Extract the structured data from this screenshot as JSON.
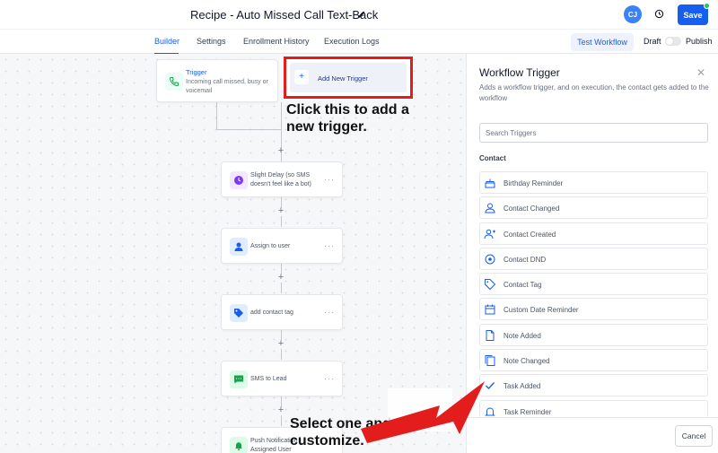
{
  "header": {
    "title": "Recipe - Auto Missed Call Text-Back",
    "avatar_initials": "CJ",
    "save_label": "Save"
  },
  "tabs": [
    {
      "label": "Builder",
      "active": true
    },
    {
      "label": "Settings"
    },
    {
      "label": "Enrollment History"
    },
    {
      "label": "Execution Logs"
    }
  ],
  "toolbar": {
    "test_label": "Test Workflow",
    "draft_label": "Draft",
    "publish_label": "Publish",
    "publish_on": false
  },
  "canvas": {
    "trigger": {
      "label": "Trigger",
      "description": "Incoming call missed, busy or voicemail"
    },
    "add_trigger_label": "Add New Trigger",
    "actions": [
      {
        "label": "Slight Delay (so SMS doesn't feel like a bot)",
        "icon": "clock-icon",
        "color": "#7c3aed"
      },
      {
        "label": "Assign to user",
        "icon": "user-icon",
        "color": "#155eef"
      },
      {
        "label": "add contact tag",
        "icon": "tag-icon",
        "color": "#155eef"
      },
      {
        "label": "SMS to Lead",
        "icon": "message-icon",
        "color": "#16a34a"
      },
      {
        "label": "Push Notification - Assigned User",
        "icon": "bell-icon",
        "color": "#16a34a"
      }
    ],
    "callout_top": "Click this to add a new trigger.",
    "callout_bottom": "Select one and customize."
  },
  "panel": {
    "title": "Workflow Trigger",
    "description": "Adds a workflow trigger, and on execution, the contact gets added to the workflow",
    "search_placeholder": "Search Triggers",
    "section_label": "Contact",
    "items": [
      {
        "label": "Birthday Reminder",
        "icon": "cake-icon"
      },
      {
        "label": "Contact Changed",
        "icon": "contacts-icon"
      },
      {
        "label": "Contact Created",
        "icon": "user-plus-icon"
      },
      {
        "label": "Contact DND",
        "icon": "dnd-icon"
      },
      {
        "label": "Contact Tag",
        "icon": "tag-icon"
      },
      {
        "label": "Custom Date Reminder",
        "icon": "calendar-icon"
      },
      {
        "label": "Note Added",
        "icon": "note-icon"
      },
      {
        "label": "Note Changed",
        "icon": "notes-icon"
      },
      {
        "label": "Task Added",
        "icon": "check-icon"
      },
      {
        "label": "Task Reminder",
        "icon": "bell-icon"
      }
    ],
    "cancel_label": "Cancel"
  },
  "colors": {
    "accent": "#155eef",
    "highlight_border": "#e31c1c",
    "annotation_arrow": "#e31c1c"
  }
}
